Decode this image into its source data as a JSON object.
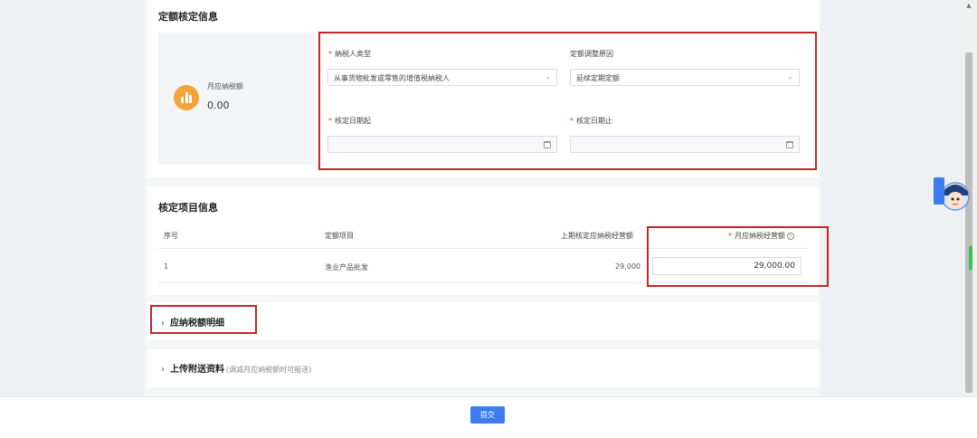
{
  "quota_section": {
    "title": "定额核定信息",
    "monthly_tax_label": "月应纳税额",
    "monthly_tax_value": "0.00",
    "taxpayer_type": {
      "label": "纳税人类型",
      "value": "从事货物批发或零售的增值税纳税人"
    },
    "adjust_reason": {
      "label": "定额调整原因",
      "value": "延续定期定额"
    },
    "start_date": {
      "label": "核定日期起",
      "value": ""
    },
    "end_date": {
      "label": "核定日期止",
      "value": ""
    }
  },
  "items_section": {
    "title": "核定项目信息",
    "columns": [
      "序号",
      "定额项目",
      "上期核定应纳税经营额",
      "月应纳税经营额"
    ],
    "rows": [
      {
        "index": "1",
        "item": "渔业产品批发",
        "previous": "29,000",
        "current": "29,000.00"
      }
    ]
  },
  "detail_section": {
    "title": "应纳税额明细"
  },
  "upload_section": {
    "title": "上传附送资料",
    "note": "(调减月应纳税额时可报送)"
  },
  "footer": {
    "submit_label": "提交"
  },
  "mascot": {
    "text": "纳税人助手"
  },
  "colors": {
    "accent": "#3d7cf0",
    "highlight_border": "#c8242b",
    "icon_orange": "#f3a33a",
    "required": "#e23c3c"
  }
}
